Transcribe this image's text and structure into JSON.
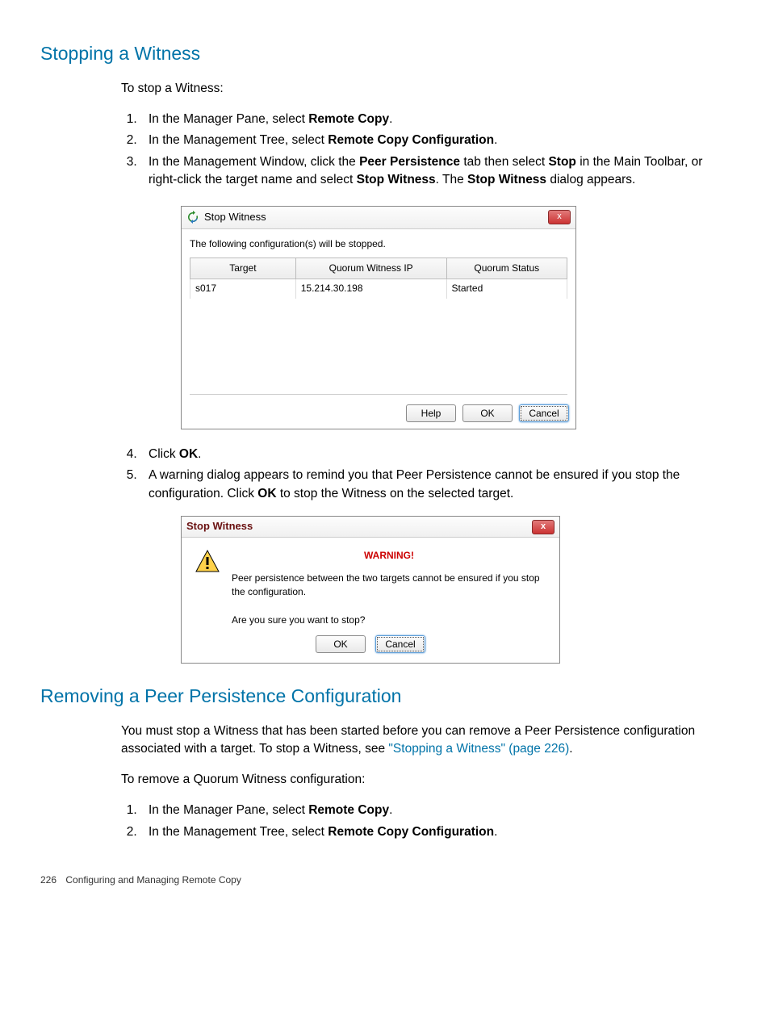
{
  "section1": {
    "heading": "Stopping a Witness",
    "intro": "To stop a Witness:",
    "step1_a": "In the Manager Pane, select ",
    "step1_b": "Remote Copy",
    "step1_c": ".",
    "step2_a": "In the Management Tree, select ",
    "step2_b": "Remote Copy Configuration",
    "step2_c": ".",
    "step3_a": "In the Management Window, click the ",
    "step3_b": "Peer Persistence",
    "step3_c": " tab then select ",
    "step3_d": "Stop",
    "step3_e": " in the Main Toolbar, or right-click the target name and select ",
    "step3_f": "Stop Witness",
    "step3_g": ". The ",
    "step3_h": "Stop Witness",
    "step3_i": " dialog appears.",
    "step4_a": "Click ",
    "step4_b": "OK",
    "step4_c": ".",
    "step5_a": "A warning dialog appears to remind you that Peer Persistence cannot be ensured if you stop the configuration. Click ",
    "step5_b": "OK",
    "step5_c": " to stop the Witness on the selected target."
  },
  "dialog1": {
    "title": "Stop Witness",
    "msg": "The following configuration(s) will be stopped.",
    "col_target": "Target",
    "col_ip": "Quorum Witness IP",
    "col_status": "Quorum Status",
    "row_target": "s017",
    "row_ip": "15.214.30.198",
    "row_status": "Started",
    "btn_help": "Help",
    "btn_ok": "OK",
    "btn_cancel": "Cancel",
    "close_glyph": "x"
  },
  "dialog2": {
    "title": "Stop Witness",
    "warning": "WARNING!",
    "line1": "Peer persistence between the two targets cannot be ensured if you stop the configuration.",
    "line2": "Are you sure you want to stop?",
    "btn_ok": "OK",
    "btn_cancel": "Cancel",
    "close_glyph": "x"
  },
  "section2": {
    "heading": "Removing a Peer Persistence Configuration",
    "p1_a": "You must stop a Witness that has been started before you can remove a Peer Persistence configuration associated with a target. To stop a Witness, see ",
    "p1_link": "\"Stopping a Witness\" (page 226)",
    "p1_b": ".",
    "p2": "To remove a Quorum Witness configuration:",
    "step1_a": "In the Manager Pane, select ",
    "step1_b": "Remote Copy",
    "step1_c": ".",
    "step2_a": "In the Management Tree, select ",
    "step2_b": "Remote Copy Configuration",
    "step2_c": "."
  },
  "footer": {
    "page": "226",
    "chapter": "Configuring and Managing Remote Copy"
  }
}
